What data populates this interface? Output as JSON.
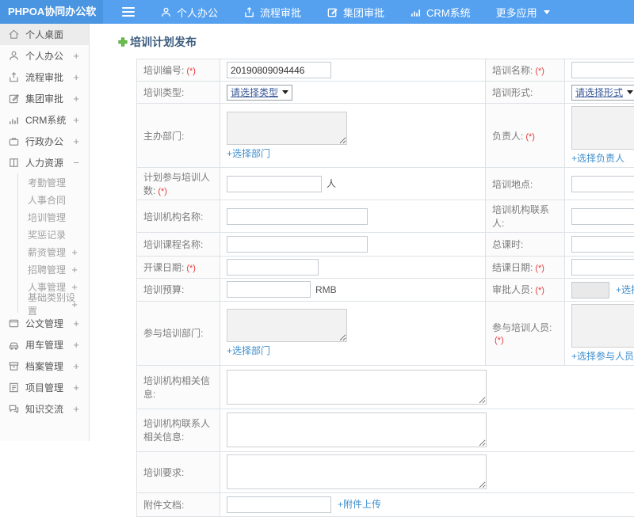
{
  "colors": {
    "header_blue": "#55a1f0",
    "logo_blue": "#4a95e1",
    "link_blue": "#3e8ece",
    "required_red": "#e53c3c",
    "plus_green": "#6abf4b",
    "title_text": "#3a5a7c"
  },
  "header": {
    "logo": "PHPOA协同办公软件",
    "nav": [
      {
        "label": "个人办公",
        "icon": "user-icon"
      },
      {
        "label": "流程审批",
        "icon": "flow-icon"
      },
      {
        "label": "集团审批",
        "icon": "edit-icon"
      },
      {
        "label": "CRM系统",
        "icon": "chart-icon"
      },
      {
        "label": "更多应用",
        "icon": "caret-down-icon"
      }
    ]
  },
  "sidebar": {
    "items": [
      {
        "label": "个人桌面",
        "icon": "home-icon",
        "active": true
      },
      {
        "label": "个人办公",
        "icon": "user-icon",
        "expand": "+"
      },
      {
        "label": "流程审批",
        "icon": "flow-icon",
        "expand": "+"
      },
      {
        "label": "集团审批",
        "icon": "edit-icon",
        "expand": "+"
      },
      {
        "label": "CRM系统",
        "icon": "chart-icon",
        "expand": "+"
      },
      {
        "label": "行政办公",
        "icon": "briefcase-icon",
        "expand": "+"
      },
      {
        "label": "人力资源",
        "icon": "book-icon",
        "expand": "−"
      }
    ],
    "hr_children": [
      {
        "label": "考勤管理"
      },
      {
        "label": "人事合同"
      },
      {
        "label": "培训管理"
      },
      {
        "label": "奖惩记录"
      },
      {
        "label": "薪资管理",
        "expand": "+"
      },
      {
        "label": "招聘管理",
        "expand": "+"
      },
      {
        "label": "人事管理",
        "expand": "+"
      },
      {
        "label": "基础类别设置",
        "expand": "+"
      }
    ],
    "items_bottom": [
      {
        "label": "公文管理",
        "icon": "doc-icon",
        "expand": "+"
      },
      {
        "label": "用车管理",
        "icon": "car-icon",
        "expand": "+"
      },
      {
        "label": "档案管理",
        "icon": "archive-icon",
        "expand": "+"
      },
      {
        "label": "项目管理",
        "icon": "project-icon",
        "expand": "+"
      },
      {
        "label": "知识交流",
        "icon": "chat-icon",
        "expand": "+"
      }
    ]
  },
  "main": {
    "title": "培训计划发布",
    "form": {
      "number": {
        "label": "培训编号:",
        "required": "(*)",
        "value": "20190809094446"
      },
      "name": {
        "label": "培训名称:",
        "required": "(*)"
      },
      "type": {
        "label": "培训类型:",
        "select": "请选择类型"
      },
      "mode": {
        "label": "培训形式:",
        "select": "请选择形式"
      },
      "dept": {
        "label": "主办部门:",
        "link": "+选择部门"
      },
      "leader": {
        "label": "负责人:",
        "required": "(*)",
        "link": "+选择负责人"
      },
      "count": {
        "label": "计划参与培训人数:",
        "required": "(*)",
        "suffix": "人"
      },
      "place": {
        "label": "培训地点:"
      },
      "org": {
        "label": "培训机构名称:"
      },
      "contact": {
        "label": "培训机构联系人:"
      },
      "course": {
        "label": "培训课程名称:"
      },
      "hours": {
        "label": "总课时:"
      },
      "start": {
        "label": "开课日期:",
        "required": "(*)"
      },
      "end": {
        "label": "结课日期:",
        "required": "(*)"
      },
      "budget": {
        "label": "培训预算:",
        "suffix": "RMB"
      },
      "approver": {
        "label": "审批人员:",
        "required": "(*)",
        "link": "+选择审批人员"
      },
      "joindept": {
        "label": "参与培训部门:",
        "link": "+选择部门"
      },
      "joinusers": {
        "label": "参与培训人员:",
        "required": "(*)",
        "link": "+选择参与人员"
      },
      "orginfo": {
        "label": "培训机构相关信息:"
      },
      "contactinfo": {
        "label": "培训机构联系人相关信息:"
      },
      "require": {
        "label": "培训要求:"
      },
      "attach": {
        "label": "附件文档:",
        "link": "+附件上传"
      }
    }
  }
}
